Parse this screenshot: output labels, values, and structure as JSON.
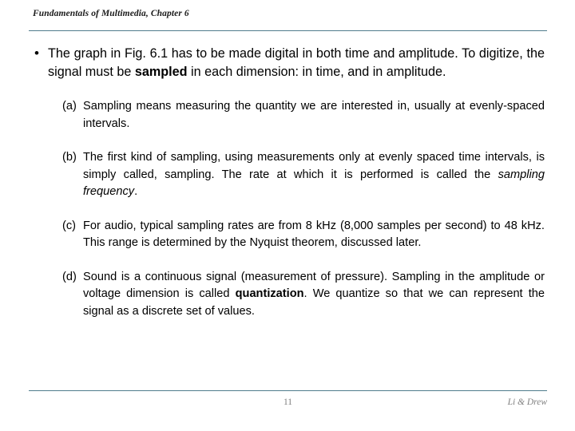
{
  "slide": {
    "header": "Fundamentals of Multimedia, Chapter 6",
    "bullet": {
      "glyph": "•",
      "part1": "The graph in Fig. 6.1 has to be made digital in both time and amplitude. To digitize, the signal must be ",
      "emphasis": "sampled",
      "part2": " in each dimension: in time, and in amplitude."
    },
    "sub_items": [
      {
        "label": "(a)",
        "part1": "Sampling means measuring the quantity we are interested in, usually at evenly-spaced intervals.",
        "emphasis": "",
        "part2": ""
      },
      {
        "label": "(b)",
        "part1": "The first kind of sampling, using measurements only at evenly spaced time intervals, is simply called, sampling. The rate at which it is performed is called the ",
        "emphasis": "sampling frequency",
        "part2": "."
      },
      {
        "label": "(c)",
        "part1": "For audio, typical sampling rates are from 8 kHz (8,000 samples per second) to 48 kHz. This range is determined by the Nyquist theorem, discussed later.",
        "emphasis": "",
        "part2": ""
      },
      {
        "label": "(d)",
        "part1": "Sound is a continuous signal (measurement of pressure). Sampling in the amplitude or voltage dimension is called ",
        "emphasis": "quantization",
        "part2": ". We quantize so that we can represent the signal as a discrete set of values."
      }
    ],
    "footer": {
      "page_number": "11",
      "authors": "Li & Drew"
    },
    "colors": {
      "rule": "#4f7c8c",
      "footer_text": "#808080",
      "body_text": "#000000",
      "background": "#ffffff"
    }
  }
}
